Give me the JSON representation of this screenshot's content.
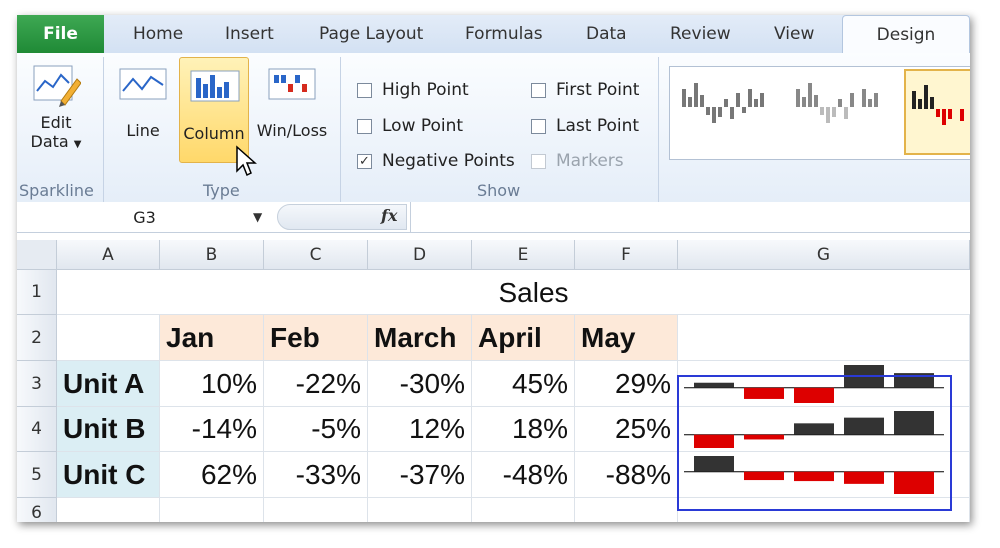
{
  "tabs": {
    "file": "File",
    "items": [
      "Home",
      "Insert",
      "Page Layout",
      "Formulas",
      "Data",
      "Review",
      "View"
    ],
    "active": "Design"
  },
  "ribbon": {
    "sparkline_group": {
      "label": "Sparkline",
      "edit_data_line1": "Edit",
      "edit_data_line2": "Data"
    },
    "type_group": {
      "label": "Type",
      "line": "Line",
      "column": "Column",
      "winloss": "Win/Loss"
    },
    "show_group": {
      "label": "Show",
      "options": [
        {
          "label": "High Point",
          "checked": false,
          "disabled": false
        },
        {
          "label": "Low Point",
          "checked": false,
          "disabled": false
        },
        {
          "label": "Negative Points",
          "checked": true,
          "disabled": false
        },
        {
          "label": "First Point",
          "checked": false,
          "disabled": false
        },
        {
          "label": "Last Point",
          "checked": false,
          "disabled": false
        },
        {
          "label": "Markers",
          "checked": false,
          "disabled": true
        }
      ]
    }
  },
  "formula_bar": {
    "name_box": "G3",
    "fx": "fx",
    "formula": ""
  },
  "sheet": {
    "columns": [
      "A",
      "B",
      "C",
      "D",
      "E",
      "F",
      "G"
    ],
    "rows": [
      "1",
      "2",
      "3",
      "4",
      "5",
      "6"
    ],
    "title": "Sales",
    "months": [
      "Jan",
      "Feb",
      "March",
      "April",
      "May"
    ],
    "units": [
      {
        "name": "Unit A",
        "values": [
          "10%",
          "-22%",
          "-30%",
          "45%",
          "29%"
        ],
        "numbers": [
          10,
          -22,
          -30,
          45,
          29
        ]
      },
      {
        "name": "Unit B",
        "values": [
          "-14%",
          "-5%",
          "12%",
          "18%",
          "25%"
        ],
        "numbers": [
          -14,
          -5,
          12,
          18,
          25
        ]
      },
      {
        "name": "Unit C",
        "values": [
          "62%",
          "-33%",
          "-37%",
          "-48%",
          "-88%"
        ],
        "numbers": [
          62,
          -33,
          -37,
          -48,
          -88
        ]
      }
    ],
    "colors": {
      "positive": "#333333",
      "negative": "#dd0000",
      "month_fill": "#fde9d9",
      "unit_fill": "#dbeef4",
      "selection": "#2a3ad6"
    }
  }
}
